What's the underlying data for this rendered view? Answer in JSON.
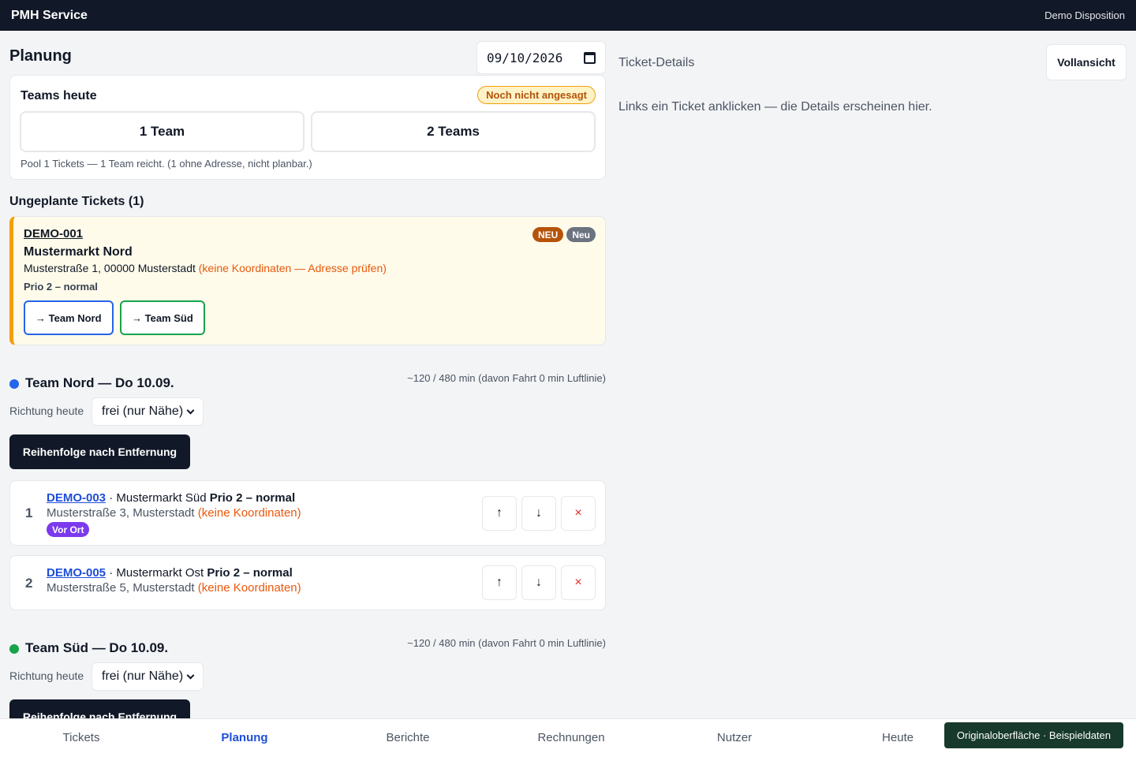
{
  "header": {
    "brand": "PMH Service",
    "user": "Demo Disposition"
  },
  "planning": {
    "title": "Planung",
    "date": "09/10/2026",
    "teams_today": {
      "label": "Teams heute",
      "status": "Noch nicht angesagt",
      "option_one": "1 Team",
      "option_two": "2 Teams",
      "hint": "Pool 1 Tickets — 1 Team reicht. (1 ohne Adresse, nicht planbar.)"
    },
    "unplanned": {
      "title": "Ungeplante Tickets (1)",
      "ticket": {
        "id": "DEMO-001",
        "name": "Mustermarkt Nord",
        "address": "Musterstraße 1, 00000 Musterstadt",
        "warning": "(keine Koordinaten — Adresse prüfen)",
        "prio": "Prio 2 – normal",
        "badges": [
          "NEU",
          "Neu"
        ],
        "assign_nord": "→ Team Nord",
        "assign_sued": "→ Team Süd"
      }
    },
    "teams": [
      {
        "name": "Team Nord — Do 10.09.",
        "color": "#2563eb",
        "stats": "~120 / 480 min (davon Fahrt 0 min Luftlinie)",
        "direction_label": "Richtung heute",
        "direction_value": "frei (nur Nähe)",
        "sort_button": "Reihenfolge nach Entfernung",
        "stops": [
          {
            "num": "1",
            "id": "DEMO-003",
            "name": "· Mustermarkt Süd",
            "prio": "Prio 2 – normal",
            "address": "Musterstraße 3, Musterstadt",
            "warning": "(keine Koordinaten)",
            "status": "Vor Ort"
          },
          {
            "num": "2",
            "id": "DEMO-005",
            "name": "· Mustermarkt Ost",
            "prio": "Prio 2 – normal",
            "address": "Musterstraße 5, Musterstadt",
            "warning": "(keine Koordinaten)"
          }
        ]
      },
      {
        "name": "Team Süd — Do 10.09.",
        "color": "#16a34a",
        "stats": "~120 / 480 min (davon Fahrt 0 min Luftlinie)",
        "direction_label": "Richtung heute",
        "direction_value": "frei (nur Nähe)",
        "sort_button": "Reihenfolge nach Entfernung"
      }
    ],
    "controls": {
      "up": "↑",
      "down": "↓",
      "remove": "×"
    }
  },
  "details": {
    "title": "Ticket-Details",
    "full_view": "Vollansicht",
    "empty": "Links ein Ticket anklicken — die Details erscheinen hier."
  },
  "nav": {
    "items": [
      "Tickets",
      "Planung",
      "Berichte",
      "Rechnungen",
      "Nutzer",
      "Heute"
    ],
    "active": "Planung",
    "badge": "Originaloberfläche · Beispieldaten"
  }
}
